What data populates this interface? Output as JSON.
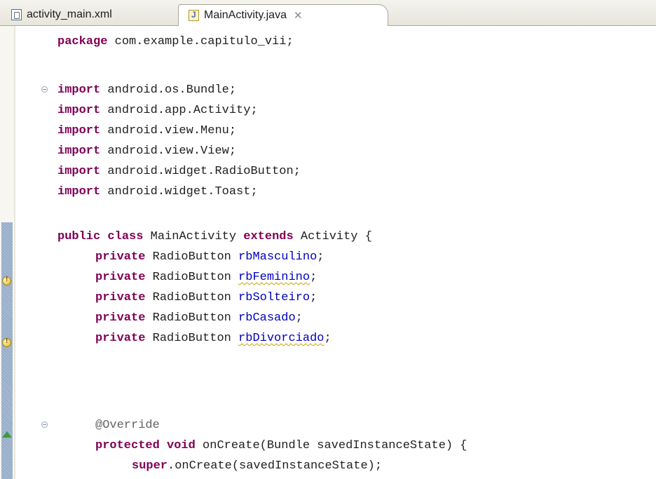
{
  "tabs": {
    "xml": {
      "label": "activity_main.xml",
      "icon": "xml-file-icon"
    },
    "java": {
      "label": "MainActivity.java",
      "icon": "java-file-icon",
      "close_icon": "close-tab-icon"
    }
  },
  "code": {
    "package_line": {
      "kw": "package",
      "rest": " com.example.capitulo_vii;"
    },
    "imports": [
      {
        "kw": "import",
        "rest": " android.os.Bundle;"
      },
      {
        "kw": "import",
        "rest": " android.app.Activity;"
      },
      {
        "kw": "import",
        "rest": " android.view.Menu;"
      },
      {
        "kw": "import",
        "rest": " android.view.View;"
      },
      {
        "kw": "import",
        "rest": " android.widget.RadioButton;"
      },
      {
        "kw": "import",
        "rest": " android.widget.Toast;"
      }
    ],
    "class_decl": {
      "kw1": "public",
      "kw2": "class",
      "name": " MainActivity ",
      "kw3": "extends",
      "rest": " Activity {"
    },
    "fields": [
      {
        "kw": "private",
        "type": " RadioButton ",
        "name": "rbMasculino",
        "end": ";",
        "warning": false
      },
      {
        "kw": "private",
        "type": " RadioButton ",
        "name": "rbFeminino",
        "end": ";",
        "warning": true
      },
      {
        "kw": "private",
        "type": " RadioButton ",
        "name": "rbSolteiro",
        "end": ";",
        "warning": false
      },
      {
        "kw": "private",
        "type": " RadioButton ",
        "name": "rbCasado",
        "end": ";",
        "warning": false
      },
      {
        "kw": "private",
        "type": " RadioButton ",
        "name": "rbDivorciado",
        "end": ";",
        "warning": true
      }
    ],
    "annotation": "@Override",
    "method_decl": {
      "kw1": "protected",
      "kw2": "void",
      "rest": " onCreate(Bundle savedInstanceState) {"
    },
    "super_call": {
      "kw": "super",
      "rest": ".onCreate(savedInstanceState);"
    }
  },
  "colors": {
    "keyword": "#7f0055",
    "field": "#0000c0",
    "annotation": "#646464",
    "warning_underline": "#c9a100"
  }
}
